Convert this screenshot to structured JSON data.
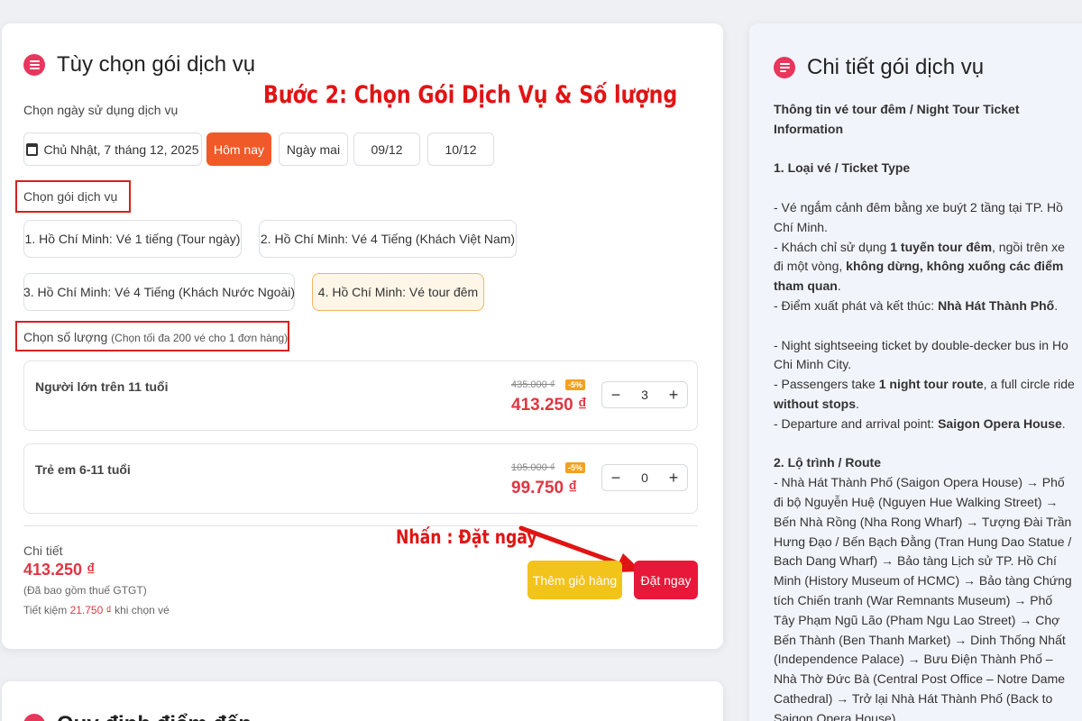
{
  "left_panel": {
    "title": "Tùy chọn gói dịch vụ",
    "date_label": "Chọn ngày sử dụng dịch vụ",
    "dates": {
      "selected": "Chủ Nhật, 7 tháng 12, 2025",
      "today": "Hôm nay",
      "tomorrow": "Ngày mai",
      "d1": "09/12",
      "d2": "10/12"
    },
    "package_label": "Chọn gói dịch vụ",
    "packages": [
      "1. Hồ Chí Minh: Vé 1 tiếng (Tour ngày)",
      "2. Hồ Chí Minh: Vé 4 Tiếng (Khách Việt Nam)",
      "3. Hồ Chí Minh: Vé 4 Tiếng (Khách Nước Ngoài)",
      "4. Hồ Chí Minh: Vé tour đêm"
    ],
    "quantity_label": "Chọn số lượng",
    "quantity_hint": "(Chọn tối đa 200 vé cho 1 đơn hàng)",
    "tickets": [
      {
        "name": "Người lớn trên 11 tuổi",
        "old_price": "435.000 ₫",
        "discount": "-5%",
        "price": "413.250 ₫",
        "qty": "3"
      },
      {
        "name": "Trẻ em 6-11 tuổi",
        "old_price": "105.000 ₫",
        "discount": "-5%",
        "price": "99.750 ₫",
        "qty": "0"
      }
    ],
    "summary": {
      "label": "Chi tiết",
      "total": "413.250 ₫",
      "tax_note": "(Đã bao gồm thuế GTGT)",
      "save_prefix": "Tiết kiệm",
      "save_amount": "21.750 ₫",
      "save_suffix": "khi chọn vé"
    },
    "add_cart": "Thêm giỏ hàng",
    "book_now": "Đặt ngay"
  },
  "annotations": {
    "step": "Bước 2: Chọn Gói Dịch Vụ & Số lượng",
    "click": "Nhấn : Đặt ngay"
  },
  "bottom_panel": {
    "title": "Quy định điểm đến"
  },
  "right_panel": {
    "title": "Chi tiết gói dịch vụ",
    "intro": "Thông tin vé tour đêm / Night Tour Ticket Information",
    "s1_title": "1. Loại vé / Ticket Type",
    "l1": "- Vé ngắm cảnh đêm bằng xe buýt 2 tầng tại TP. Hồ Chí Minh.",
    "l2a": "- Khách chỉ sử dụng ",
    "l2b": "1 tuyến tour đêm",
    "l2c": ", ngồi trên xe đi một vòng, ",
    "l2d": "không dừng, không xuống các điểm tham quan",
    "l2e": ".",
    "l3a": "- Điểm xuất phát và kết thúc: ",
    "l3b": "Nhà Hát Thành Phố",
    "l3c": ".",
    "l4": "- Night sightseeing ticket by double-decker bus in Ho Chi Minh City.",
    "l5a": "- Passengers take ",
    "l5b": "1 night tour route",
    "l5c": ", a full circle ride ",
    "l5d": "without stops",
    "l5e": ".",
    "l6a": "- Departure and arrival point: ",
    "l6b": "Saigon Opera House",
    "l6c": ".",
    "s2_title": "2. Lộ trình / Route",
    "route": "- Nhà Hát Thành Phố (Saigon Opera House) → Phố đi bộ Nguyễn Huệ (Nguyen Hue Walking Street) → Bến Nhà Rồng (Nha Rong Wharf) → Tượng Đài Trần Hưng Đạo / Bến Bạch Đằng (Tran Hung Dao Statue / Bach Dang Wharf) → Bảo tàng Lịch sử TP. Hồ Chí Minh (History Museum of HCMC) → Bảo tàng Chứng tích Chiến tranh (War Remnants Museum) → Phố Tây Phạm Ngũ Lão (Pham Ngu Lao Street) → Chợ Bến Thành (Ben Thanh Market) → Dinh Thống Nhất (Independence Palace) → Bưu Điện Thành Phố – Nhà Thờ Đức Bà (Central Post Office – Notre Dame Cathedral) → Trở lại Nhà Hát Thành Phố (Back to Saigon Opera House)"
  },
  "colors": {
    "accent": "#e8365d",
    "orange": "#f05a28",
    "price_red": "#e03542",
    "annotation_red": "#d6211e",
    "cart_yellow": "#f2c31a",
    "book_red": "#e8183a"
  }
}
